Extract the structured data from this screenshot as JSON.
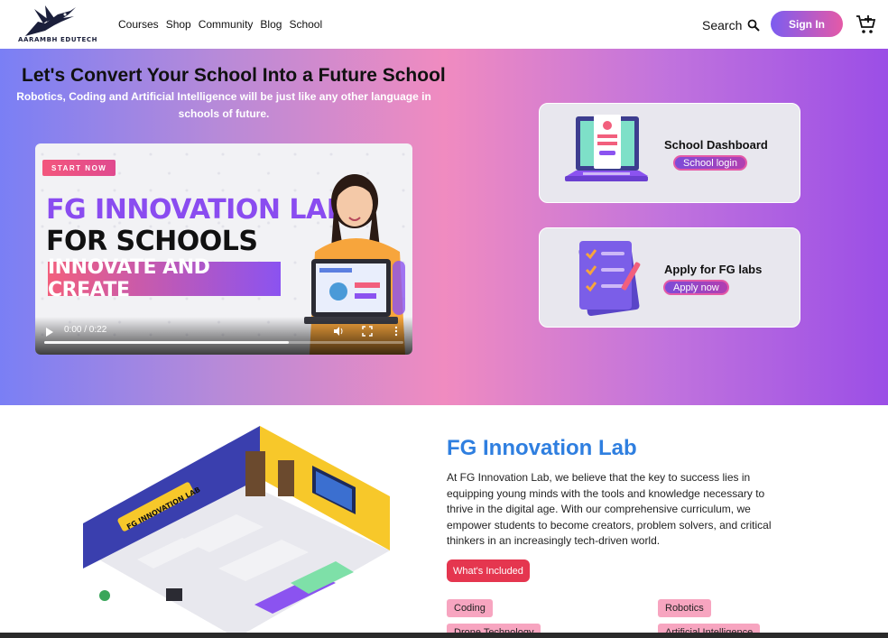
{
  "header": {
    "logo_text": "AARAMBH EDUTECH",
    "nav": [
      "Courses",
      "Shop",
      "Community",
      "Blog",
      "School"
    ],
    "search_label": "Search",
    "search_icon": "magnifier",
    "signin_label": "Sign In",
    "cart_icon": "cart-plus"
  },
  "hero": {
    "title": "Let's Convert Your School Into a Future School",
    "subtitle": "Robotics, Coding and Artificial Intelligence will be just like any other language in schools of future.",
    "video": {
      "badge": "START NOW",
      "line1": "FG INNOVATION LAB",
      "line2": "FOR SCHOOLS",
      "banner": "INNOVATE AND CREATE",
      "time": "0:00 / 0:22",
      "progress_fraction": 0.68
    },
    "cards": [
      {
        "title": "School Dashboard",
        "button": "School login",
        "icon": "laptop-login"
      },
      {
        "title": "Apply for FG labs",
        "button": "Apply now",
        "icon": "checklist"
      }
    ]
  },
  "section": {
    "title": "FG Innovation Lab",
    "paragraph": "At FG Innovation Lab, we believe that the key to success lies in equipping young minds with the tools and knowledge necessary to thrive in the digital age. With our comprehensive curriculum, we empower students to become creators, problem solvers, and critical thinkers in an increasingly tech-driven world.",
    "whats_included": "What's Included",
    "tags": [
      "Coding",
      "Robotics",
      "Drone Technology",
      "Artificial Intelligence"
    ],
    "illustration_sign": "FG INNOVATION LAB"
  },
  "colors": {
    "accent_blue": "#2f7fe0",
    "accent_red": "#e5364f",
    "tag_pink": "#f7a5c0",
    "signin_gradient_start": "#7c5cf0",
    "signin_gradient_end": "#e45aa7"
  }
}
